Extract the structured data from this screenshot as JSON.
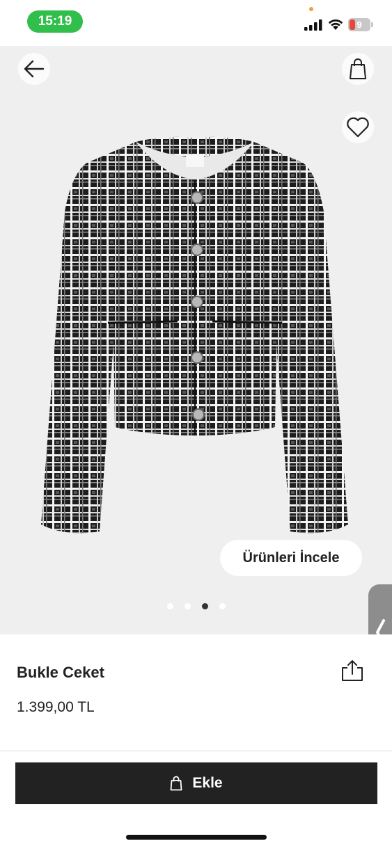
{
  "status_bar": {
    "time": "15:19",
    "battery_level": "9",
    "colors": {
      "time_pill": "#2fbf4a",
      "battery_low": "#e5483a",
      "privacy_dot": "#f2a03d"
    },
    "icons": [
      "cellular-signal-icon",
      "wifi-icon",
      "battery-icon"
    ]
  },
  "nav": {
    "icons": {
      "back": "arrow-left-icon",
      "bag": "shopping-bag-icon",
      "favorite": "heart-outline-icon"
    }
  },
  "gallery": {
    "explore_label": "Ürünleri İncele",
    "image_count": 4,
    "active_index": 2,
    "product_image": "black-white-boucle-jacket"
  },
  "product": {
    "name": "Bukle Ceket",
    "price": "1.399,00 TL",
    "share_icon": "share-icon"
  },
  "cta": {
    "add_label": "Ekle",
    "add_icon": "shopping-bag-icon",
    "color": "#222222"
  },
  "side_handle": {
    "icon": "chevron-left-icon"
  }
}
